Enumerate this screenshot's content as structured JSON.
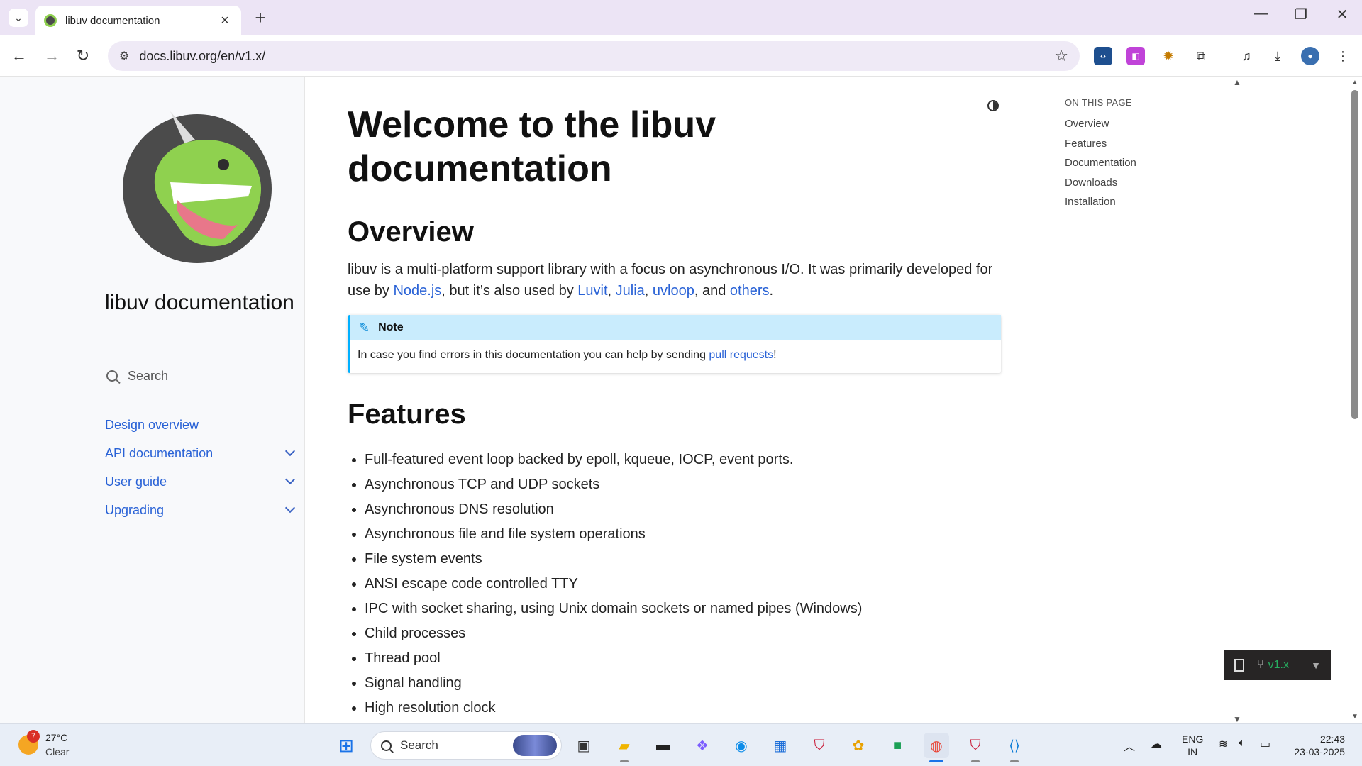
{
  "browser": {
    "tab_title": "libuv documentation",
    "url": "docs.libuv.org/en/v1.x/"
  },
  "sidebar": {
    "site_title": "libuv documentation",
    "search_placeholder": "Search",
    "items": [
      {
        "label": "Design overview",
        "expandable": false
      },
      {
        "label": "API documentation",
        "expandable": true
      },
      {
        "label": "User guide",
        "expandable": true
      },
      {
        "label": "Upgrading",
        "expandable": true
      }
    ]
  },
  "content": {
    "title": "Welcome to the libuv documentation",
    "overview": {
      "heading": "Overview",
      "text_1": "libuv is a multi-platform support library with a focus on asynchronous I/O. It was primarily developed for use by ",
      "link_node": "Node.js",
      "text_2": ", but it’s also used by ",
      "link_luvit": "Luvit",
      "sep_1": ", ",
      "link_julia": "Julia",
      "sep_2": ", ",
      "link_uvloop": "uvloop",
      "text_3": ", and ",
      "link_others": "others",
      "text_4": "."
    },
    "note": {
      "title": "Note",
      "text": "In case you find errors in this documentation you can help by sending ",
      "link": "pull requests",
      "end": "!"
    },
    "features": {
      "heading": "Features",
      "items": [
        "Full-featured event loop backed by epoll, kqueue, IOCP, event ports.",
        "Asynchronous TCP and UDP sockets",
        "Asynchronous DNS resolution",
        "Asynchronous file and file system operations",
        "File system events",
        "ANSI escape code controlled TTY",
        "IPC with socket sharing, using Unix domain sockets or named pipes (Windows)",
        "Child processes",
        "Thread pool",
        "Signal handling",
        "High resolution clock"
      ]
    }
  },
  "toc": {
    "title": "ON THIS PAGE",
    "items": [
      "Overview",
      "Features",
      "Documentation",
      "Downloads",
      "Installation"
    ]
  },
  "version_badge": {
    "label": "v1.x"
  },
  "taskbar": {
    "weather_badge": "7",
    "weather_temp": "27°C",
    "weather_condition": "Clear",
    "search_label": "Search",
    "lang_1": "ENG",
    "lang_2": "IN",
    "time": "22:43",
    "date": "23-03-2025"
  },
  "colors": {
    "link": "#2962d6",
    "note_accent": "#00b0ff",
    "note_header_bg": "#c9ecfd",
    "version_green": "#27ae60",
    "logo_green": "#8fd14f",
    "logo_dark": "#4b4b4b"
  }
}
